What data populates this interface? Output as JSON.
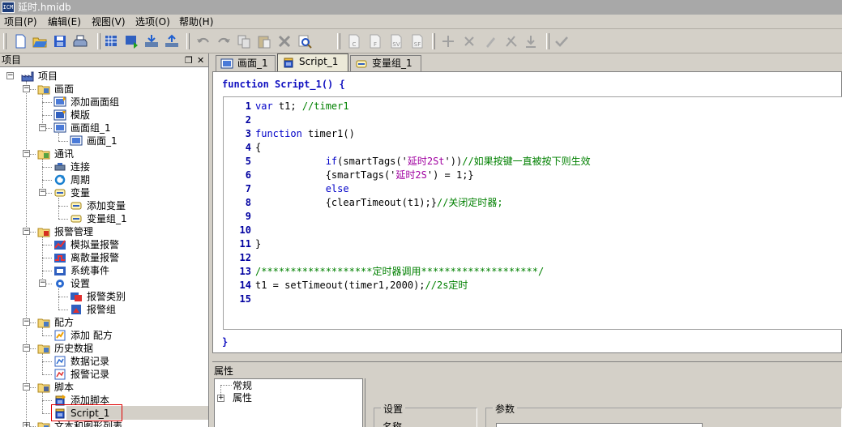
{
  "window": {
    "title": "延时.hmidb",
    "app_icon_text": "ICM"
  },
  "menu": [
    "项目(P)",
    "编辑(E)",
    "视图(V)",
    "选项(O)",
    "帮助(H)"
  ],
  "toolbar": {
    "buttons": [
      "new-icon",
      "open-icon",
      "save-icon",
      "print-icon",
      "screen-grid-icon",
      "screen-export-icon",
      "download-icon",
      "deploy-icon",
      "undo-icon",
      "redo-icon",
      "copy-icon",
      "paste-icon",
      "delete-icon",
      "find-icon",
      "check-c-icon",
      "check-f-icon",
      "check-sv-icon",
      "check-sf-icon",
      "bp-add-icon",
      "bp-remove-icon",
      "bp-edit-icon",
      "bp-clear-icon",
      "bp-import-icon",
      "checkmark-icon"
    ],
    "badges": {
      "check-c-icon": "C",
      "check-f-icon": "F",
      "check-sv-icon": "SV",
      "check-sf-icon": "SF"
    }
  },
  "project_panel": {
    "title": "项目",
    "controls": [
      "restore-icon",
      "close-icon"
    ],
    "tree": [
      {
        "label": "项目",
        "icon": "factory-icon",
        "depth": 0,
        "expander": "−"
      },
      {
        "label": "画面",
        "icon": "folder-screen-icon",
        "depth": 1,
        "expander": "−"
      },
      {
        "label": "添加画面组",
        "icon": "add-screen-group-icon",
        "depth": 2
      },
      {
        "label": "模版",
        "icon": "template-icon",
        "depth": 2
      },
      {
        "label": "画面组_1",
        "icon": "screen-group-icon",
        "depth": 2,
        "expander": "−"
      },
      {
        "label": "画面_1",
        "icon": "screen-icon",
        "depth": 3
      },
      {
        "label": "通讯",
        "icon": "folder-comm-icon",
        "depth": 1,
        "expander": "−"
      },
      {
        "label": "连接",
        "icon": "connection-icon",
        "depth": 2
      },
      {
        "label": "周期",
        "icon": "cycle-icon",
        "depth": 2
      },
      {
        "label": "变量",
        "icon": "variable-icon",
        "depth": 2,
        "expander": "−"
      },
      {
        "label": "添加变量",
        "icon": "add-variable-icon",
        "depth": 3
      },
      {
        "label": "变量组_1",
        "icon": "variable-group-icon",
        "depth": 3
      },
      {
        "label": "报警管理",
        "icon": "folder-alarm-icon",
        "depth": 1,
        "expander": "−"
      },
      {
        "label": "模拟量报警",
        "icon": "analog-alarm-icon",
        "depth": 2
      },
      {
        "label": "离散量报警",
        "icon": "discrete-alarm-icon",
        "depth": 2
      },
      {
        "label": "系统事件",
        "icon": "system-event-icon",
        "depth": 2
      },
      {
        "label": "设置",
        "icon": "settings-icon",
        "depth": 2,
        "expander": "−"
      },
      {
        "label": "报警类别",
        "icon": "alarm-class-icon",
        "depth": 3
      },
      {
        "label": "报警组",
        "icon": "alarm-group-icon",
        "depth": 3
      },
      {
        "label": "配方",
        "icon": "folder-recipe-icon",
        "depth": 1,
        "expander": "−"
      },
      {
        "label": "添加 配方",
        "icon": "add-recipe-icon",
        "depth": 2
      },
      {
        "label": "历史数据",
        "icon": "folder-history-icon",
        "depth": 1,
        "expander": "−"
      },
      {
        "label": "数据记录",
        "icon": "data-log-icon",
        "depth": 2
      },
      {
        "label": "报警记录",
        "icon": "alarm-log-icon",
        "depth": 2
      },
      {
        "label": "脚本",
        "icon": "folder-script-icon",
        "depth": 1,
        "expander": "−"
      },
      {
        "label": "添加脚本",
        "icon": "add-script-icon",
        "depth": 2
      },
      {
        "label": "Script_1",
        "icon": "script-icon",
        "depth": 2,
        "selected": true
      },
      {
        "label": "文本和图形列表",
        "icon": "folder-text-icon",
        "depth": 1,
        "expander": "+"
      }
    ]
  },
  "tabs": [
    {
      "label": "画面_1",
      "icon": "screen-icon"
    },
    {
      "label": "Script_1",
      "icon": "script-icon",
      "active": true
    },
    {
      "label": "变量组_1",
      "icon": "variable-group-icon"
    }
  ],
  "editor": {
    "function_header": "function Script_1() {",
    "function_footer": "}",
    "lines": [
      {
        "n": "1",
        "tokens": [
          [
            "kw",
            "var "
          ],
          [
            "fn",
            "t1; "
          ],
          [
            "cm",
            "//timer1"
          ]
        ]
      },
      {
        "n": "2",
        "tokens": []
      },
      {
        "n": "3",
        "tokens": [
          [
            "kw",
            "function "
          ],
          [
            "fn",
            "timer1()"
          ]
        ]
      },
      {
        "n": "4",
        "tokens": [
          [
            "fn",
            "{"
          ]
        ]
      },
      {
        "n": "5",
        "tokens": [
          [
            "fn",
            "            "
          ],
          [
            "kw",
            "if"
          ],
          [
            "fn",
            "(smartTags('"
          ],
          [
            "st",
            "延时2St"
          ],
          [
            "fn",
            "'))"
          ],
          [
            "cm",
            "//如果按键一直被按下则生效"
          ]
        ]
      },
      {
        "n": "6",
        "tokens": [
          [
            "fn",
            "            {smartTags('"
          ],
          [
            "st",
            "延时2S"
          ],
          [
            "fn",
            "') = 1;}"
          ]
        ]
      },
      {
        "n": "7",
        "tokens": [
          [
            "fn",
            "            "
          ],
          [
            "kw",
            "else"
          ]
        ]
      },
      {
        "n": "8",
        "tokens": [
          [
            "fn",
            "            {clearTimeout(t1);}"
          ],
          [
            "cm",
            "//关闭定时器;"
          ]
        ]
      },
      {
        "n": "9",
        "tokens": []
      },
      {
        "n": "10",
        "tokens": []
      },
      {
        "n": "11",
        "tokens": [
          [
            "fn",
            "}"
          ]
        ]
      },
      {
        "n": "12",
        "tokens": []
      },
      {
        "n": "13",
        "tokens": [
          [
            "cm",
            "/*******************定时器调用********************/"
          ]
        ]
      },
      {
        "n": "14",
        "tokens": [
          [
            "fn",
            "t1 = setTimeout(timer1,2000);"
          ],
          [
            "cm",
            "//2s定时"
          ]
        ]
      },
      {
        "n": "15",
        "tokens": []
      }
    ]
  },
  "properties": {
    "title": "属性",
    "tree": [
      {
        "label": "常规",
        "expander": ""
      },
      {
        "label": "属性",
        "expander": "+"
      }
    ],
    "groups": {
      "settings": "设置",
      "parameters": "参数"
    },
    "name_label": "名称"
  }
}
